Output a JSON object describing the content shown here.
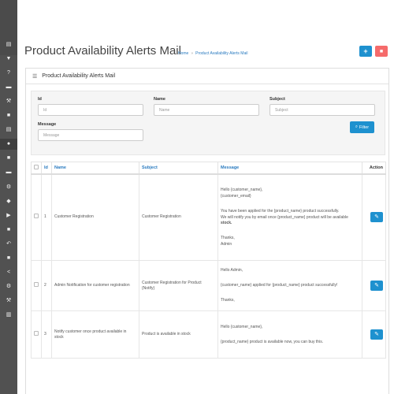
{
  "sidebar": {
    "icons": [
      {
        "name": "dashboard-icon",
        "glyph": "▤"
      },
      {
        "name": "tag-icon",
        "glyph": "▼"
      },
      {
        "name": "help-icon",
        "glyph": "?"
      },
      {
        "name": "card-icon",
        "glyph": "▬"
      },
      {
        "name": "wrench-icon",
        "glyph": "⚒"
      },
      {
        "name": "file-icon",
        "glyph": "■"
      },
      {
        "name": "book-icon",
        "glyph": "▤"
      },
      {
        "name": "user-icon",
        "glyph": "●"
      },
      {
        "name": "trash-icon",
        "glyph": "■"
      },
      {
        "name": "bed-icon",
        "glyph": "▬"
      },
      {
        "name": "cogs-icon",
        "glyph": "⚙"
      },
      {
        "name": "tags-icon",
        "glyph": "◆"
      },
      {
        "name": "truck-icon",
        "glyph": "▶"
      },
      {
        "name": "cart-icon",
        "glyph": "■"
      },
      {
        "name": "reply-icon",
        "glyph": "↶"
      },
      {
        "name": "shopping-cart-icon",
        "glyph": "■"
      },
      {
        "name": "share-icon",
        "glyph": "<"
      },
      {
        "name": "settings-icon",
        "glyph": "⚙"
      },
      {
        "name": "tools-icon",
        "glyph": "⚒"
      },
      {
        "name": "chart-icon",
        "glyph": "▥"
      }
    ]
  },
  "header": {
    "title": "Product Availability Alerts Mail",
    "breadcrumb_home": "Home",
    "breadcrumb_separator": "»",
    "breadcrumb_current": "Product Availability Alerts Mail",
    "add_glyph": "+",
    "delete_glyph": "■"
  },
  "panel": {
    "title": "Product Availability Alerts Mail",
    "list_glyph": "☰"
  },
  "filter": {
    "id_label": "Id",
    "id_placeholder": "Id",
    "name_label": "Name",
    "name_placeholder": "Name",
    "subject_label": "Subject",
    "subject_placeholder": "Subject",
    "message_label": "Message",
    "message_placeholder": "Message",
    "button_label": "Filter",
    "button_glyph": "⌕"
  },
  "table": {
    "headers": {
      "id": "Id",
      "name": "Name",
      "subject": "Subject",
      "message": "Message",
      "action": "Action"
    },
    "edit_glyph": "✎",
    "rows": [
      {
        "id": "1",
        "name": "Customer Registration",
        "subject": "Customer Registration",
        "message": {
          "l1": "Hello {customer_name},",
          "l2": "{customer_email}",
          "l3": "You have been applied for the {product_name} product successfully.",
          "l4": "We will notify you by email once {product_name} product will be available",
          "l4_bold": "stock.",
          "l5": "Thanks,",
          "l6": "Admin"
        }
      },
      {
        "id": "2",
        "name": "Admin Notification for customer registration",
        "subject": "Customer Registration for Product {Notify}",
        "message": {
          "l1": "Hello Admin,",
          "l2": "{customer_name} applied for {product_name} product successfully!",
          "l3": "Thanks,"
        }
      },
      {
        "id": "3",
        "name": "Notify customer once product available in stock",
        "subject": "Product is available in stock",
        "message": {
          "l1": "Hello {customer_name},",
          "l2": "{product_name} product is available now, you can buy this."
        }
      }
    ]
  }
}
